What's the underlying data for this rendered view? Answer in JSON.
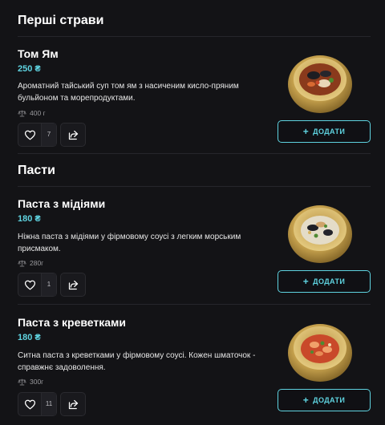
{
  "sections": {
    "first": {
      "title": "Перші страви"
    },
    "pasta": {
      "title": "Пасти"
    }
  },
  "items": [
    {
      "name": "Том Ям",
      "price": "250 ₴",
      "description": "Ароматний тайський суп том ям з насиченим кисло-пряним бульйоном та морепродуктами.",
      "weight": "400 г",
      "likes": "7",
      "add_label": "ДОДАТИ",
      "image": "tom-yum-soup-bowl"
    },
    {
      "name": "Паста з мідіями",
      "price": "180 ₴",
      "description": "Ніжна паста з мідіями у фірмовому соусі з легким морським присмаком.",
      "weight": "280г",
      "likes": "1",
      "add_label": "ДОДАТИ",
      "image": "mussel-pasta-bowl"
    },
    {
      "name": "Паста з креветками",
      "price": "180 ₴",
      "description": "Ситна паста з креветками  у фірмовому соусі. Кожен шматочок - справжнє задоволення.",
      "weight": "300г",
      "likes": "11",
      "add_label": "ДОДАТИ",
      "image": "shrimp-pasta-bowl"
    }
  ],
  "icons": {
    "like": "heart-icon",
    "share": "share-icon",
    "weight": "scale-icon",
    "add": "plus-icon"
  },
  "colors": {
    "background": "#131316",
    "accent": "#5fd3e0",
    "bowl_gold": "#c9a44f"
  }
}
